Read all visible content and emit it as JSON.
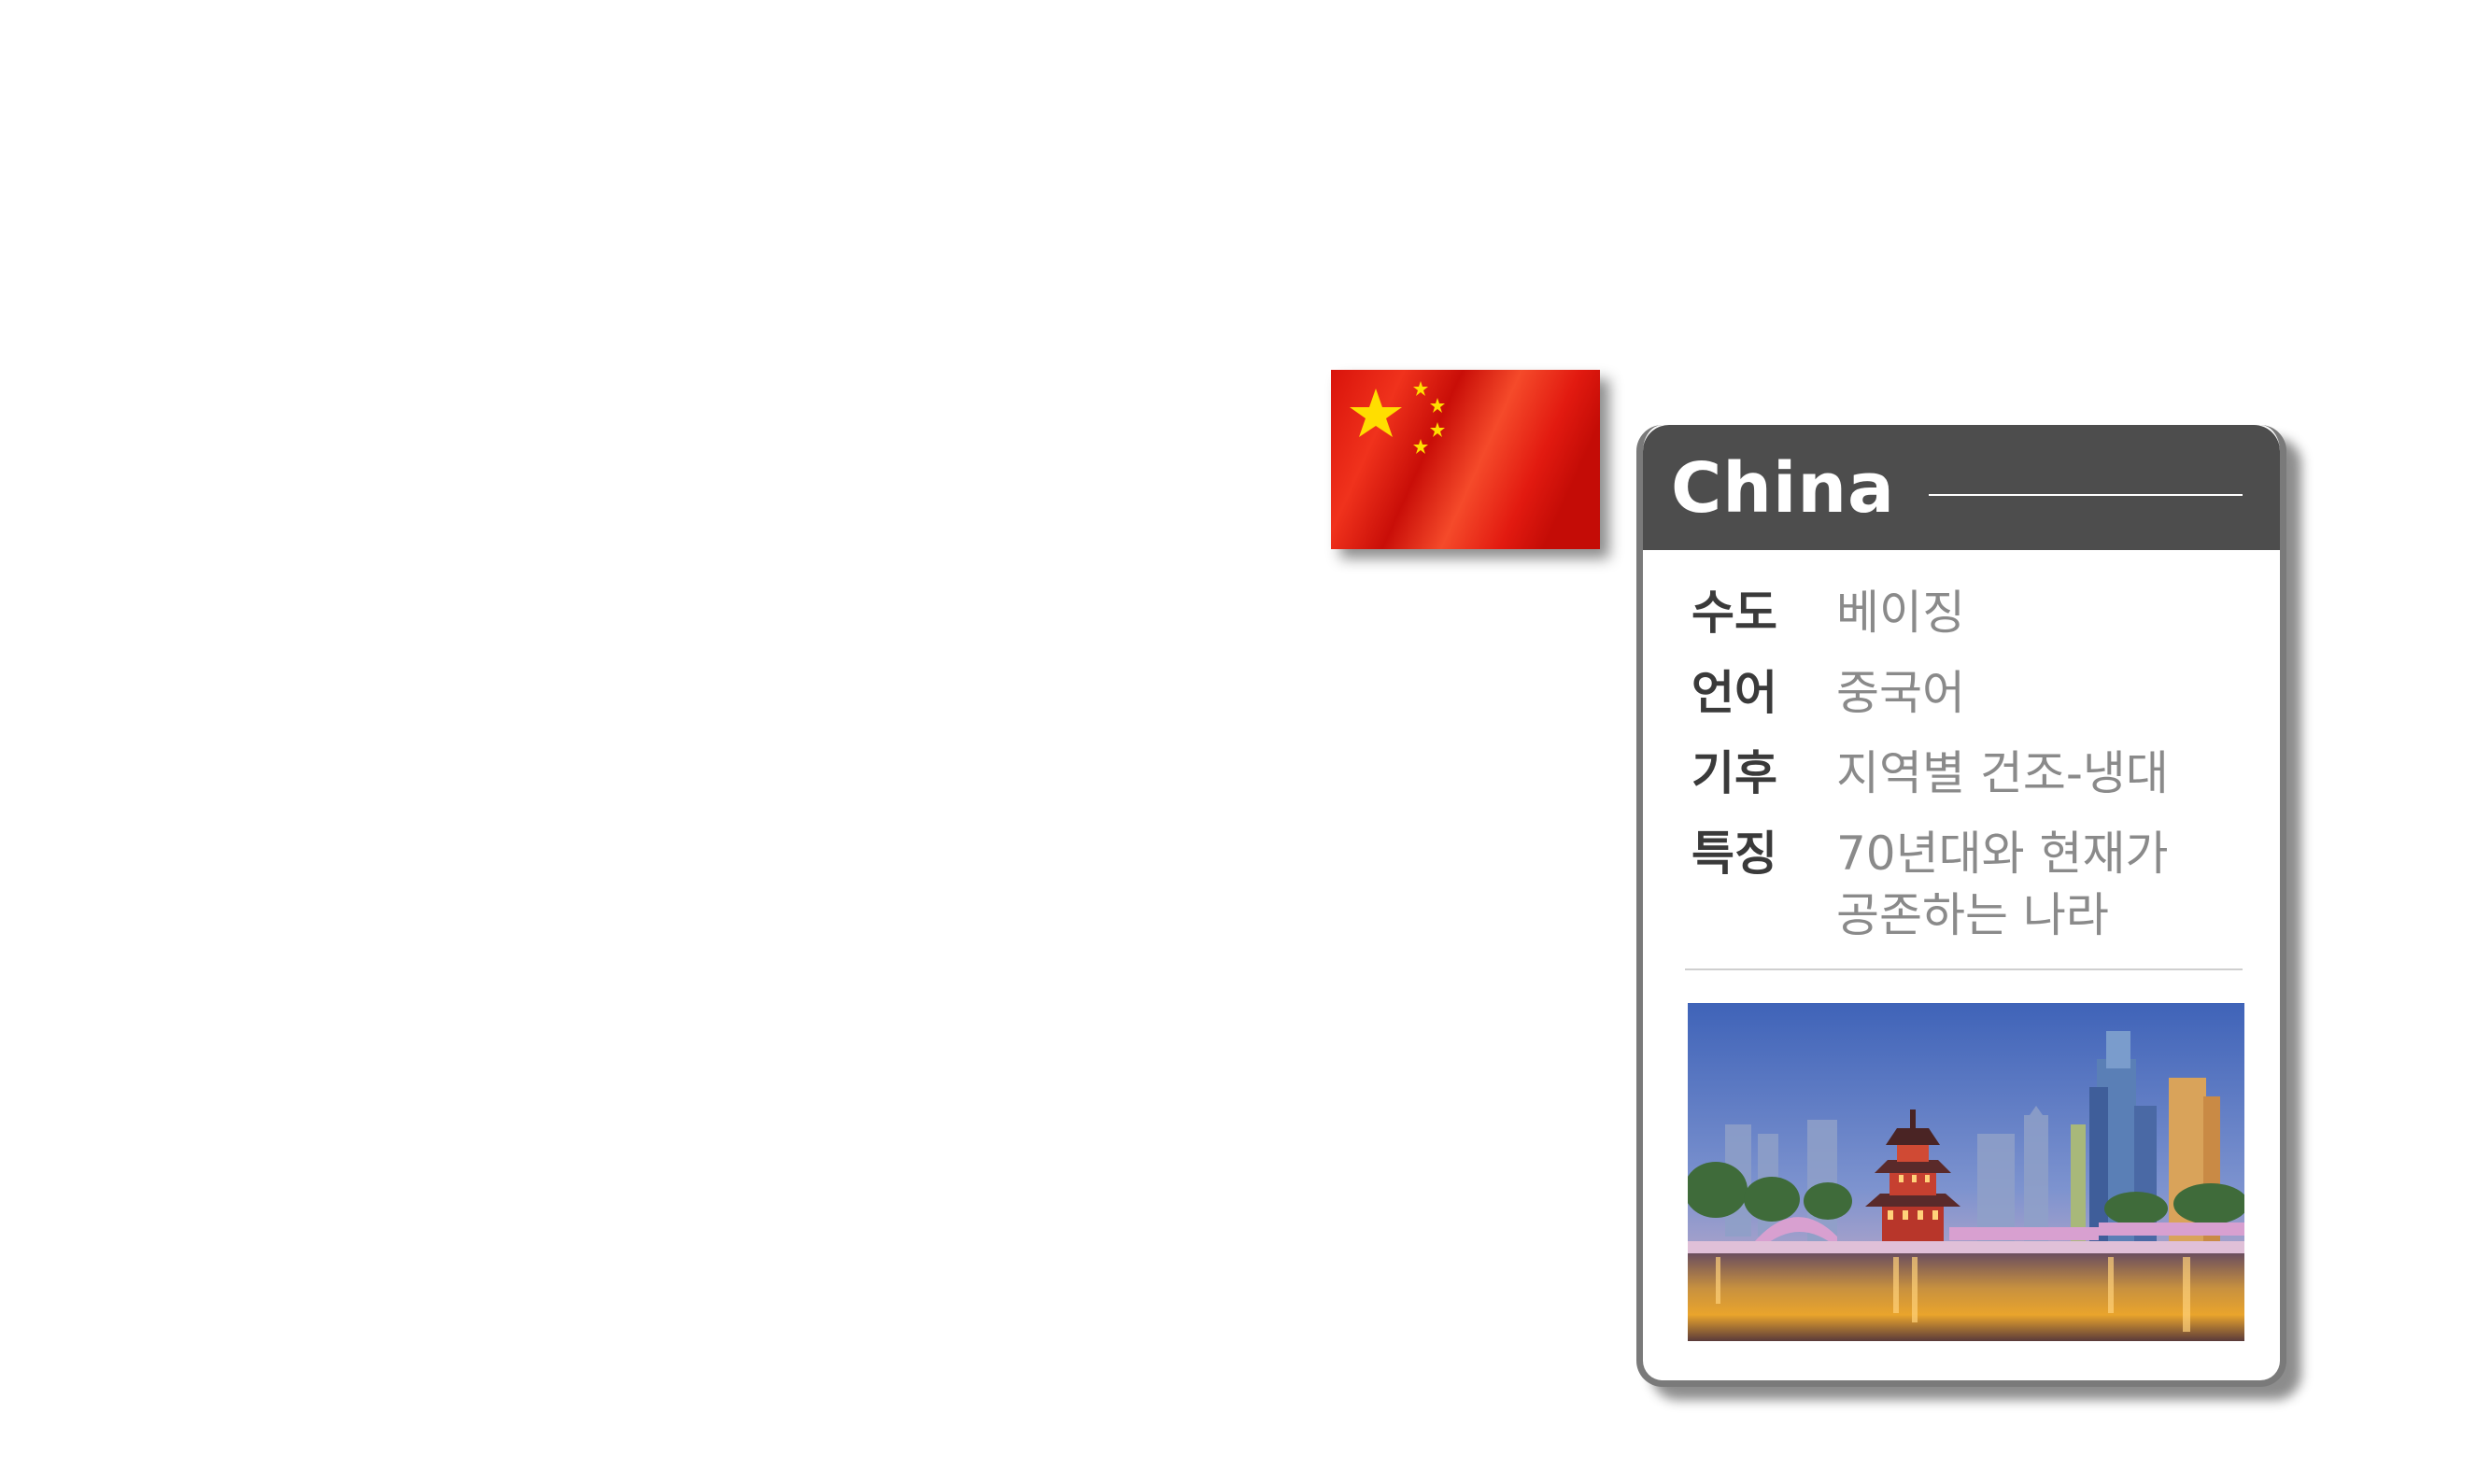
{
  "country": {
    "name": "China",
    "flag_icon": "china-flag-icon",
    "flag_colors": {
      "field": "#e0190f",
      "stars": "#ffde00"
    }
  },
  "info": [
    {
      "label": "수도",
      "value": "베이징"
    },
    {
      "label": "언어",
      "value": "중국어"
    },
    {
      "label": "기후",
      "value": "지역별 건조-냉대"
    },
    {
      "label": "특징",
      "value": "70년대와 현재가\n공존하는 나라"
    }
  ],
  "photo": {
    "icon": "city-skyline-image"
  },
  "colors": {
    "header_bg": "#4d4d4d",
    "card_border": "#7a7a7a",
    "label_text": "#3a3a3a",
    "value_text": "#8a8a8a"
  }
}
